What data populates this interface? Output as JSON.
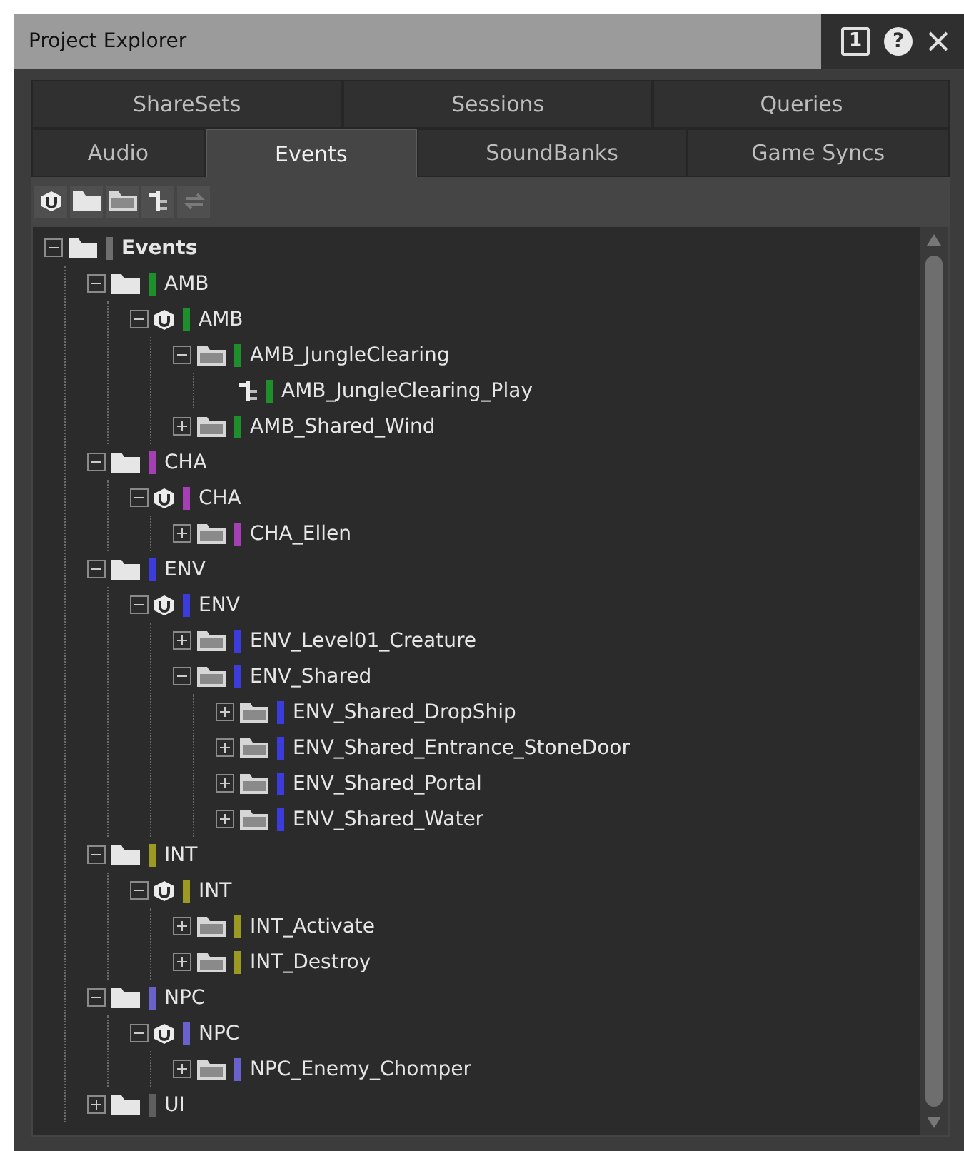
{
  "window": {
    "title": "Project Explorer",
    "buttons": [
      {
        "kind": "instance",
        "label": "1"
      },
      {
        "kind": "help",
        "label": "?"
      },
      {
        "kind": "close"
      }
    ]
  },
  "tab_rows": [
    [
      {
        "label": "ShareSets",
        "selected": false
      },
      {
        "label": "Sessions",
        "selected": false
      },
      {
        "label": "Queries",
        "selected": false
      }
    ],
    [
      {
        "label": "Audio",
        "selected": false
      },
      {
        "label": "Events",
        "selected": true
      },
      {
        "label": "SoundBanks",
        "selected": false
      },
      {
        "label": "Game Syncs",
        "selected": false
      }
    ]
  ],
  "toolbar": [
    {
      "kind": "unit"
    },
    {
      "kind": "workunit"
    },
    {
      "kind": "folder"
    },
    {
      "kind": "event"
    },
    {
      "kind": "link"
    }
  ],
  "tree": [
    {
      "kind": "workunit",
      "label": "Events",
      "color": "#6e6e6e",
      "expanded": true,
      "children": [
        {
          "kind": "workunit",
          "label": "AMB",
          "color": "#1f8f2c",
          "expanded": true,
          "children": [
            {
              "kind": "unit",
              "label": "AMB",
              "color": "#1f8f2c",
              "expanded": true,
              "children": [
                {
                  "kind": "folder",
                  "label": "AMB_JungleClearing",
                  "color": "#1f8f2c",
                  "expanded": true,
                  "children": [
                    {
                      "kind": "event",
                      "label": "AMB_JungleClearing_Play",
                      "color": "#1f8f2c"
                    }
                  ]
                },
                {
                  "kind": "folder",
                  "label": "AMB_Shared_Wind",
                  "color": "#1f8f2c",
                  "expanded": false
                }
              ]
            }
          ]
        },
        {
          "kind": "workunit",
          "label": "CHA",
          "color": "#a43fb4",
          "expanded": true,
          "children": [
            {
              "kind": "unit",
              "label": "CHA",
              "color": "#a43fb4",
              "expanded": true,
              "children": [
                {
                  "kind": "folder",
                  "label": "CHA_Ellen",
                  "color": "#a43fb4",
                  "expanded": false
                }
              ]
            }
          ]
        },
        {
          "kind": "workunit",
          "label": "ENV",
          "color": "#3c3cdc",
          "expanded": true,
          "children": [
            {
              "kind": "unit",
              "label": "ENV",
              "color": "#3c3cdc",
              "expanded": true,
              "children": [
                {
                  "kind": "folder",
                  "label": "ENV_Level01_Creature",
                  "color": "#3c3cdc",
                  "expanded": false
                },
                {
                  "kind": "folder",
                  "label": "ENV_Shared",
                  "color": "#3c3cdc",
                  "expanded": true,
                  "children": [
                    {
                      "kind": "folder",
                      "label": "ENV_Shared_DropShip",
                      "color": "#3c3cdc",
                      "expanded": false
                    },
                    {
                      "kind": "folder",
                      "label": "ENV_Shared_Entrance_StoneDoor",
                      "color": "#3c3cdc",
                      "expanded": false
                    },
                    {
                      "kind": "folder",
                      "label": "ENV_Shared_Portal",
                      "color": "#3c3cdc",
                      "expanded": false
                    },
                    {
                      "kind": "folder",
                      "label": "ENV_Shared_Water",
                      "color": "#3c3cdc",
                      "expanded": false
                    }
                  ]
                }
              ]
            }
          ]
        },
        {
          "kind": "workunit",
          "label": "INT",
          "color": "#9c9a22",
          "expanded": true,
          "children": [
            {
              "kind": "unit",
              "label": "INT",
              "color": "#9c9a22",
              "expanded": true,
              "children": [
                {
                  "kind": "folder",
                  "label": "INT_Activate",
                  "color": "#9c9a22",
                  "expanded": false
                },
                {
                  "kind": "folder",
                  "label": "INT_Destroy",
                  "color": "#9c9a22",
                  "expanded": false
                }
              ]
            }
          ]
        },
        {
          "kind": "workunit",
          "label": "NPC",
          "color": "#6a62cc",
          "expanded": true,
          "children": [
            {
              "kind": "unit",
              "label": "NPC",
              "color": "#6a62cc",
              "expanded": true,
              "children": [
                {
                  "kind": "folder",
                  "label": "NPC_Enemy_Chomper",
                  "color": "#6a62cc",
                  "expanded": false
                }
              ]
            }
          ]
        },
        {
          "kind": "workunit",
          "label": "UI",
          "color": "#5e5e5e",
          "expanded": false
        }
      ]
    }
  ]
}
